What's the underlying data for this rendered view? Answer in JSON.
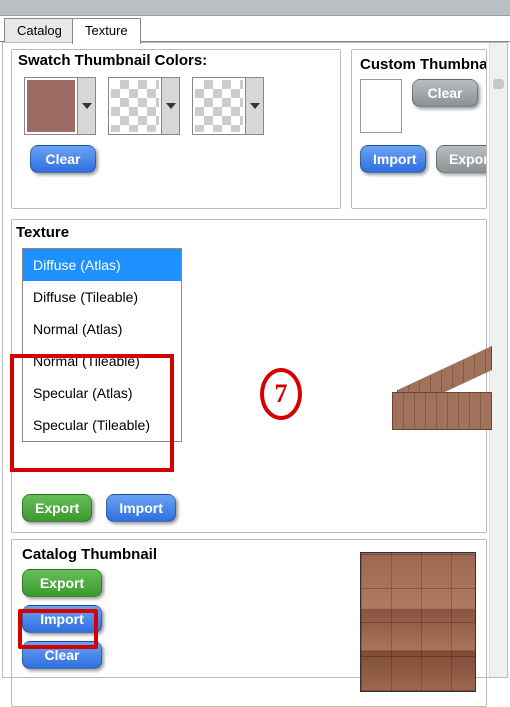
{
  "tabs": {
    "catalog": "Catalog",
    "texture": "Texture"
  },
  "swatch": {
    "title": "Swatch Thumbnail Colors:",
    "clear": "Clear",
    "color1": "#9b6a63"
  },
  "custom": {
    "title": "Custom Thumbnail",
    "clear": "Clear",
    "import": "Import",
    "export": "Export"
  },
  "texture": {
    "title": "Texture",
    "items": [
      "Diffuse (Atlas)",
      "Diffuse (Tileable)",
      "Normal (Atlas)",
      "Normal (Tileable)",
      "Specular (Atlas)",
      "Specular (Tileable)"
    ],
    "export": "Export",
    "import": "Import"
  },
  "catalog_thumb": {
    "title": "Catalog Thumbnail",
    "export": "Export",
    "import": "Import",
    "clear": "Clear"
  },
  "annotation": {
    "number": "7"
  }
}
